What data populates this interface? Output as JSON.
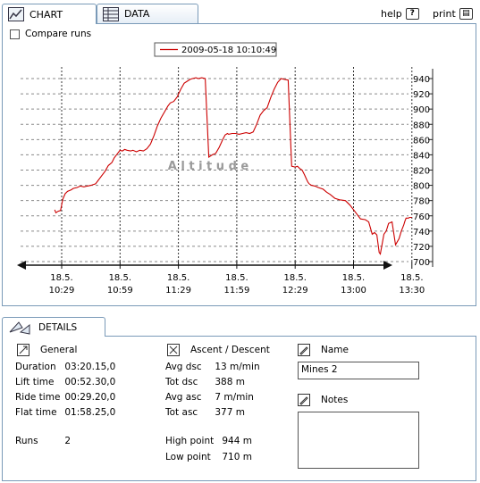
{
  "tabs": {
    "chart": "CHART",
    "data": "DATA"
  },
  "toolbar": {
    "help": "help",
    "print": "print"
  },
  "compare_label": "Compare runs",
  "chart_data": {
    "type": "line",
    "legend": "2009-05-18 10:10:49",
    "watermark": "A l t i t u d e",
    "ylim": [
      700,
      940
    ],
    "yticks": [
      700,
      720,
      740,
      760,
      780,
      800,
      820,
      840,
      860,
      880,
      900,
      920,
      940
    ],
    "xticks": [
      {
        "d": "18.5.",
        "t": "10:29"
      },
      {
        "d": "18.5.",
        "t": "10:59"
      },
      {
        "d": "18.5.",
        "t": "11:29"
      },
      {
        "d": "18.5.",
        "t": "11:59"
      },
      {
        "d": "18.5.",
        "t": "12:29"
      },
      {
        "d": "18.5.",
        "t": "13:00"
      },
      {
        "d": "18.5.",
        "t": "13:30"
      }
    ],
    "line_color": "#cc0000",
    "series": [
      {
        "x": [
          -0.6,
          -0.5,
          -0.3,
          -0.1,
          0.1,
          0.3,
          0.5,
          0.8,
          1.0,
          1.3,
          1.6,
          1.9,
          2.2,
          2.5,
          2.9,
          3.1,
          3.4,
          3.7,
          4.0,
          4.3,
          4.5,
          4.8,
          5.0,
          5.2,
          5.4,
          5.6,
          5.9,
          6.1,
          6.4,
          6.7,
          7.0,
          7.3,
          7.6,
          7.9,
          8.2,
          8.5,
          8.8,
          9.1,
          9.3,
          9.6,
          9.9,
          10.2,
          10.5,
          10.8,
          11.0,
          11.2,
          11.5,
          11.7,
          12.0,
          12.3,
          12.6,
          12.9,
          13.2,
          13.5,
          13.8,
          14.0,
          14.1,
          14.2,
          14.3,
          14.6,
          14.9,
          15.2,
          15.5,
          15.8,
          16.1,
          16.4,
          16.7,
          17.0,
          17.3,
          17.6,
          17.9,
          18.2,
          18.5,
          18.8,
          19.1,
          19.4,
          19.7,
          20.0,
          20.2,
          20.4,
          20.6,
          20.8,
          21.0,
          21.1,
          21.2,
          21.4,
          21.7,
          22.0,
          22.4,
          22.7,
          23.0,
          23.4,
          23.8,
          24.3,
          24.7,
          25.1,
          25.6,
          26.0,
          26.3,
          26.6,
          26.8,
          27.0,
          27.2,
          27.3,
          27.6,
          27.8,
          28.0,
          28.3,
          28.6,
          28.9,
          29.1,
          29.3,
          29.4,
          29.5,
          29.7,
          29.8,
          29.9,
          30.0
        ],
        "y": [
          768,
          764,
          766,
          767,
          782,
          789,
          792,
          794,
          796,
          797,
          799,
          798,
          799,
          800,
          802,
          806,
          812,
          818,
          826,
          830,
          836,
          842,
          846,
          845,
          847,
          846,
          845,
          846,
          844,
          846,
          845,
          848,
          854,
          865,
          878,
          888,
          896,
          904,
          908,
          910,
          916,
          926,
          934,
          937,
          939,
          940,
          941,
          940,
          941,
          940,
          837,
          840,
          842,
          850,
          860,
          866,
          867,
          868,
          867,
          868,
          868,
          867,
          868,
          869,
          868,
          870,
          880,
          892,
          898,
          902,
          915,
          926,
          935,
          940,
          939,
          938,
          825,
          824,
          825,
          822,
          820,
          814,
          807,
          804,
          802,
          800,
          799,
          797,
          795,
          791,
          788,
          783,
          781,
          780,
          774,
          766,
          756,
          755,
          752,
          736,
          738,
          735,
          712,
          710,
          736,
          740,
          750,
          752,
          722,
          730,
          740,
          748,
          753,
          757,
          757,
          758,
          758,
          758
        ]
      }
    ]
  },
  "details": {
    "tab_label": "DETAILS",
    "general": {
      "title": "General",
      "rows": [
        {
          "k": "Duration",
          "v": "03:20.15,0"
        },
        {
          "k": "Lift time",
          "v": "00:52.30,0"
        },
        {
          "k": "Ride time",
          "v": "00:29.20,0"
        },
        {
          "k": "Flat time",
          "v": "01:58.25,0"
        }
      ],
      "runs_label": "Runs",
      "runs_value": "2"
    },
    "ascent": {
      "title": "Ascent / Descent",
      "rows": [
        {
          "k": "Avg dsc",
          "v": "13 m/min"
        },
        {
          "k": "Tot dsc",
          "v": "388 m"
        },
        {
          "k": "Avg asc",
          "v": "7 m/min"
        },
        {
          "k": "Tot asc",
          "v": "377 m"
        }
      ],
      "high_label": "High point",
      "high_value": "944 m",
      "low_label": "Low point",
      "low_value": "710 m"
    },
    "name": {
      "title": "Name",
      "value": "Mines 2"
    },
    "notes": {
      "title": "Notes",
      "value": ""
    }
  }
}
